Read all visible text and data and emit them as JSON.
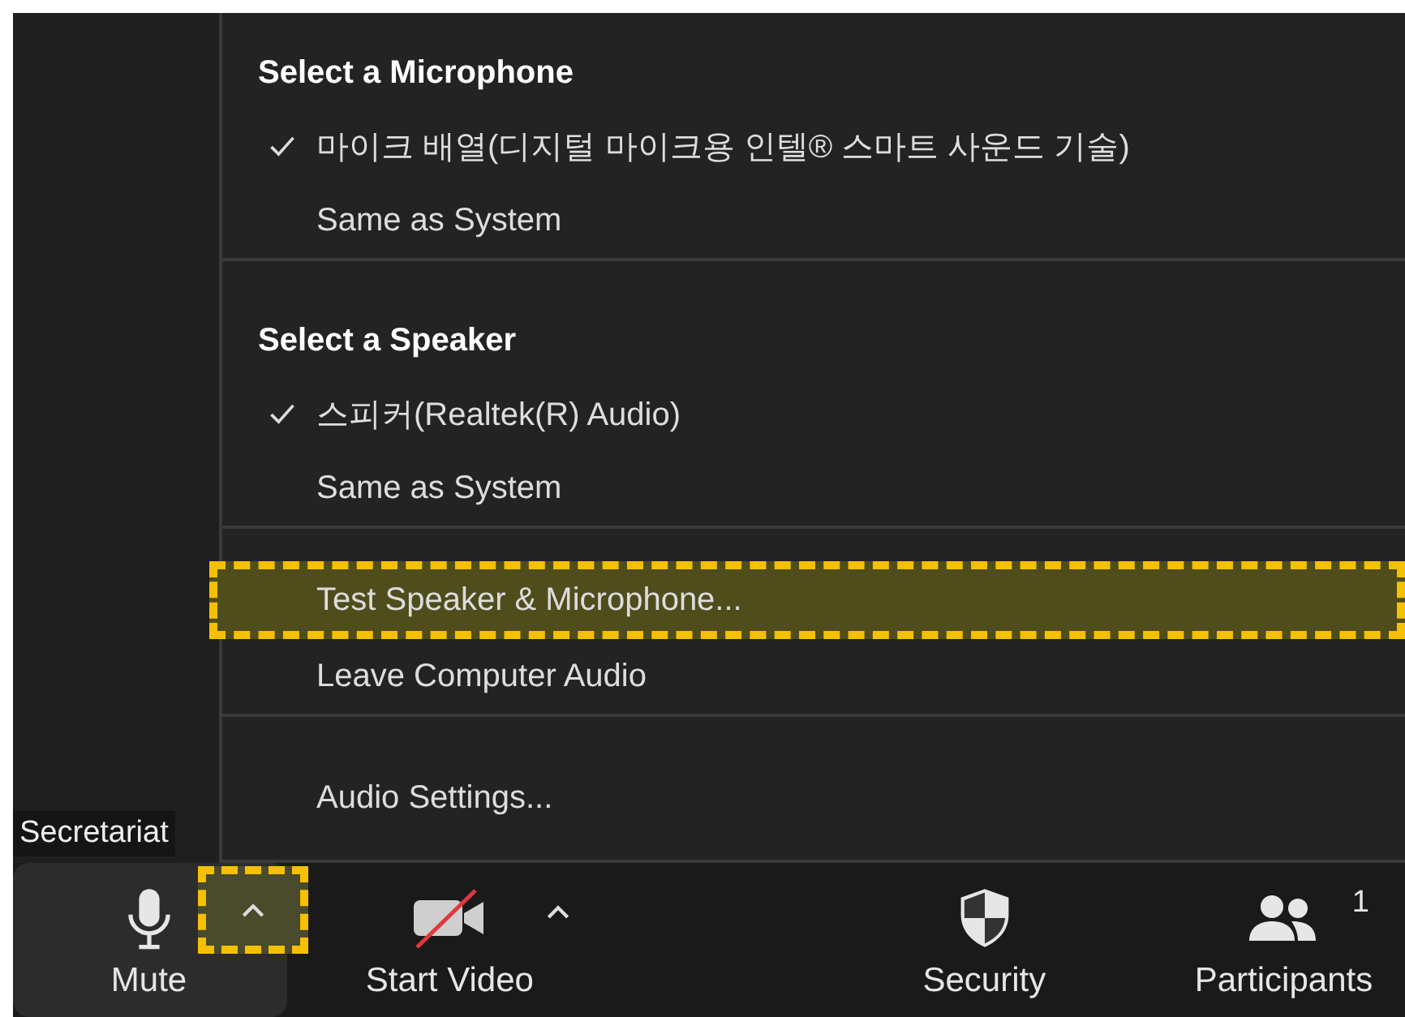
{
  "name_tag": "Secretariat",
  "audio_menu": {
    "sections": [
      {
        "title": "Select a Microphone",
        "items": [
          {
            "label": "마이크 배열(디지털 마이크용 인텔® 스마트 사운드 기술)",
            "checked": true,
            "highlighted": false
          },
          {
            "label": "Same as System",
            "checked": false,
            "highlighted": false
          }
        ]
      },
      {
        "title": "Select a Speaker",
        "items": [
          {
            "label": "스피커(Realtek(R) Audio)",
            "checked": true,
            "highlighted": false
          },
          {
            "label": "Same as System",
            "checked": false,
            "highlighted": false
          }
        ]
      },
      {
        "items": [
          {
            "label": "Test Speaker & Microphone...",
            "checked": false,
            "highlighted": true
          },
          {
            "label": "Leave Computer Audio",
            "checked": false,
            "highlighted": false
          }
        ]
      },
      {
        "items": [
          {
            "label": "Audio Settings...",
            "checked": false,
            "highlighted": false
          }
        ]
      }
    ]
  },
  "toolbar": [
    {
      "kind": "mute",
      "label": "Mute",
      "caret": true,
      "caret_highlighted": true,
      "active": true
    },
    {
      "kind": "video",
      "label": "Start Video",
      "caret": true,
      "caret_highlighted": false,
      "active": false
    },
    {
      "kind": "security",
      "label": "Security",
      "active": false
    },
    {
      "kind": "participants",
      "label": "Participants",
      "count": "1",
      "active": false
    }
  ]
}
